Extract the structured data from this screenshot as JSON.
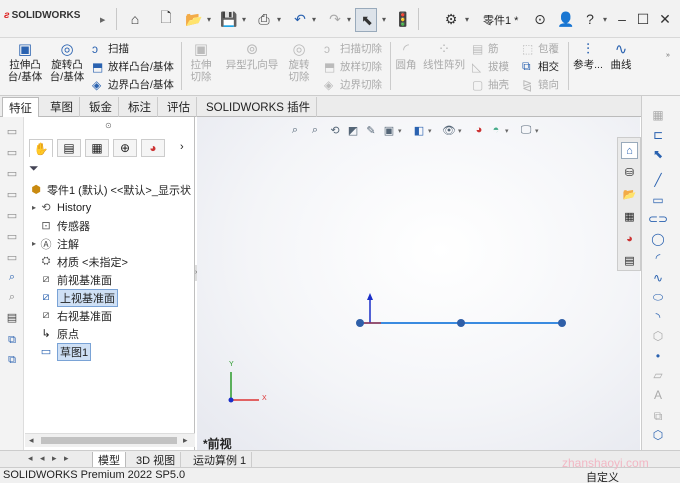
{
  "app": {
    "logo_text": "SOLIDWORKS",
    "document_title": "零件1 *"
  },
  "ribbon": {
    "extruded_boss": "拉伸凸台/基体",
    "revolved_boss": "旋转凸台/基体",
    "swept_boss": "扫描",
    "lofted_boss": "放样凸台/基体",
    "boundary_boss": "边界凸台/基体",
    "extruded_cut": "拉伸切除",
    "hole_wizard": "异型孔向导",
    "revolved_cut": "旋转切除",
    "swept_cut": "扫描切除",
    "lofted_cut": "放样切除",
    "boundary_cut": "边界切除",
    "fillet": "圆角",
    "linear_pattern": "线性阵列",
    "rib": "筋",
    "draft": "拔模",
    "shell": "抽壳",
    "wrap": "包覆",
    "intersect": "相交",
    "mirror": "镜向",
    "reference_geometry": "参考...",
    "curves": "曲线"
  },
  "tabs": [
    "特征",
    "草图",
    "钣金",
    "标注",
    "评估",
    "SOLIDWORKS 插件"
  ],
  "tree": {
    "root": "零件1 (默认) <<默认>_显示状",
    "items": [
      "History",
      "传感器",
      "注解",
      "材质 <未指定>",
      "前视基准面",
      "上视基准面",
      "右视基准面",
      "原点",
      "草图1"
    ]
  },
  "bottom_tabs": [
    "模型",
    "3D 视图",
    "运动算例 1"
  ],
  "status": {
    "version": "SOLIDWORKS Premium 2022 SP5.0",
    "custom": "自定义",
    "watermark": "zhanshaoyi.com"
  },
  "viewport": {
    "view_label": "*前视",
    "triad": {
      "x": "X",
      "y": "Y"
    }
  },
  "colors": {
    "sketch_line": "#3a8be0",
    "accent": "#2a62b0",
    "logo_red": "#d22222"
  }
}
